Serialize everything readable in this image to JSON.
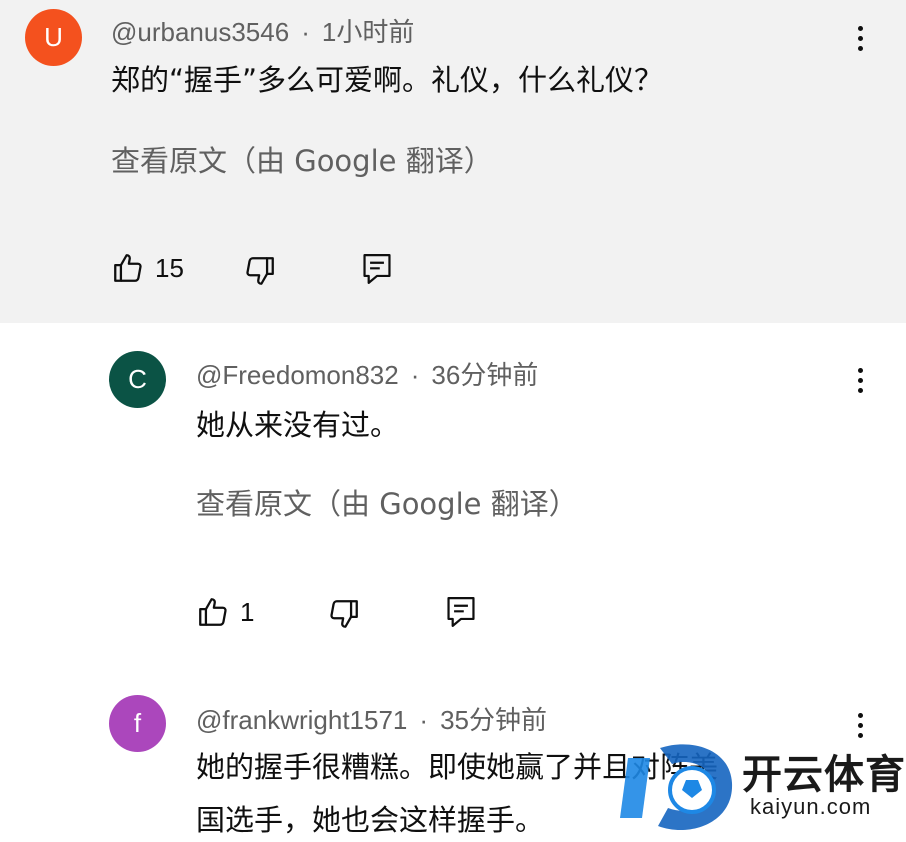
{
  "comments": [
    {
      "avatar_letter": "U",
      "avatar_color": "#f4511e",
      "username": "@urbanus3546",
      "separator": "·",
      "time": "1小时前",
      "text": "郑的“握手”多么可爱啊。礼仪，什么礼仪？",
      "translate": "查看原文（由 Google 翻译）",
      "likes": "15"
    },
    {
      "avatar_letter": "C",
      "avatar_color": "#0b5345",
      "username": "@Freedomon832",
      "separator": "·",
      "time": "36分钟前",
      "text": "她从来没有过。",
      "translate": "查看原文（由 Google 翻译）",
      "likes": "1"
    },
    {
      "avatar_letter": "f",
      "avatar_color": "#ab47bc",
      "username": "@frankwright1571",
      "separator": "·",
      "time": "35分钟前",
      "text_line1": "她的握手很糟糕。即使她赢了并且对阵美",
      "text_line2": "国选手，她也会这样握手。"
    }
  ],
  "icons": {
    "like": "thumbs-up-icon",
    "dislike": "thumbs-down-icon",
    "reply": "reply-icon",
    "more": "more-vert-icon"
  },
  "watermark": {
    "title": "开云体育",
    "subtitle": "kaiyun.com",
    "accent_color": "#1e88e5"
  }
}
